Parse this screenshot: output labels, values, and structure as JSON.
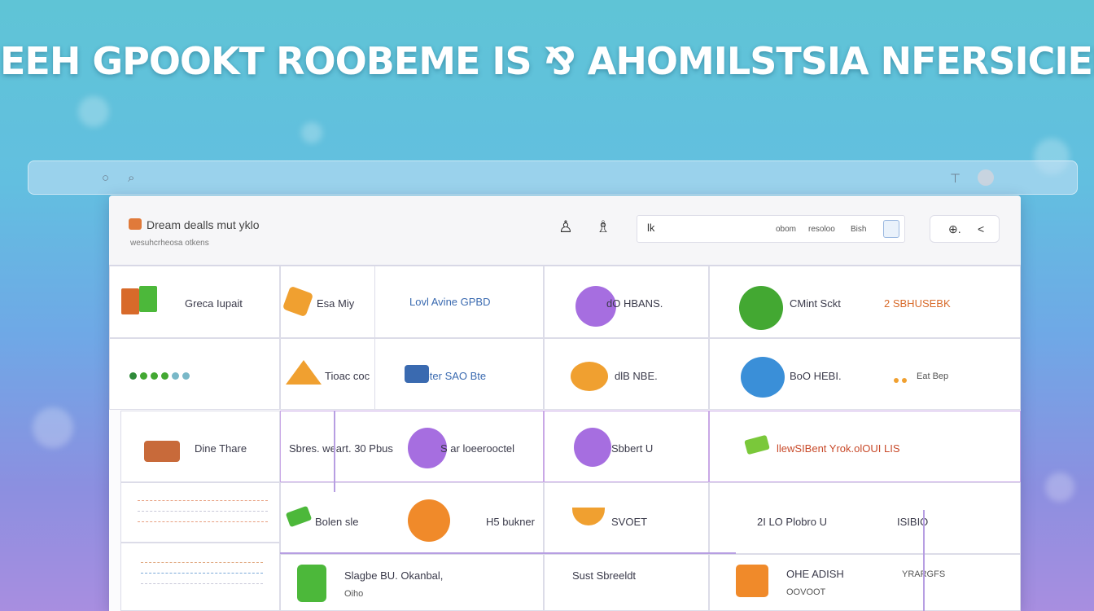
{
  "banner": {
    "title": "EEH GPOOKT ROOBEME IS ⅋ AHOMILSTSIA NFERSICIER"
  },
  "header": {
    "app_title": "Dream dealls mut yklo",
    "app_subtitle": "wesuhcrheosa otkens",
    "search": {
      "left_text": "lk",
      "item1": "obom",
      "item2": "resoloo",
      "item3": "Bish"
    },
    "user_menu": {
      "label": "⊕.",
      "chevron": "<"
    }
  },
  "grid": {
    "row1": [
      {
        "label": "Greca Iupait"
      },
      {
        "label": "Esa Miy"
      },
      {
        "label": "Lovl Avine GPBD"
      },
      {
        "label": "dO HBANS."
      },
      {
        "label": "CMint Sckt"
      },
      {
        "label": "2 SBHUSEBK"
      }
    ],
    "row2": [
      {
        "label": ""
      },
      {
        "label": "Tioac coc"
      },
      {
        "label": "Elbter SAO Bte"
      },
      {
        "label": "dlB NBE."
      },
      {
        "label": "BoO HEBI."
      },
      {
        "label": "Eat Bep"
      }
    ],
    "row3": [
      {
        "label": "Dine Thare"
      },
      {
        "label": "Sbres. weart. 30 Pbus"
      },
      {
        "label": "S ar loeerooctel"
      },
      {
        "label": "Sbbert U"
      },
      {
        "label": "llewSIBent Yrok.olOUI LIS"
      }
    ],
    "row4": [
      {
        "label": "Bolen sle"
      },
      {
        "label": "H5 bukner"
      },
      {
        "label": "SVOET"
      },
      {
        "label": "2I LO Plobro U"
      },
      {
        "label": "ISIBIO"
      }
    ],
    "row5": [
      {
        "label": "Slagbe BU. Okanbal,",
        "sub": "Oiho"
      },
      {
        "label": "Sust Sbreeldt"
      },
      {
        "label": "OHE ADISH",
        "sub": "OOVOOT"
      },
      {
        "label": "YRARGFS"
      }
    ]
  },
  "colors": {
    "orange": "#f0932b",
    "green": "#43a832",
    "purple": "#a66ee0",
    "blue": "#3a8fd8",
    "accent_line": "#b79ee2"
  }
}
